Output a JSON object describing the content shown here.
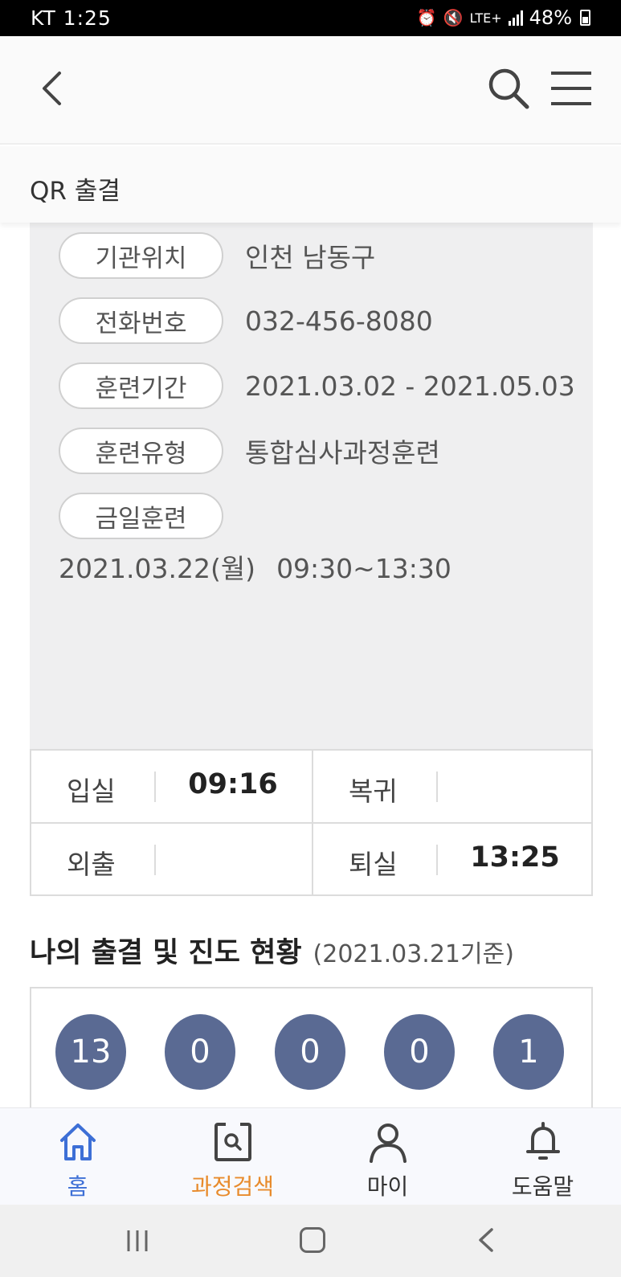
{
  "status_bar": {
    "carrier_time": "KT 1:25",
    "network": "LTE+",
    "battery": "48%"
  },
  "header": {
    "back_icon": "chevron-left-icon",
    "search_icon": "search-icon",
    "menu_icon": "hamburger-menu-icon"
  },
  "subheader": {
    "title": "QR 출결"
  },
  "info": {
    "rows": [
      {
        "label": "기관위치",
        "value": "인천 남동구"
      },
      {
        "label": "전화번호",
        "value": "032-456-8080"
      },
      {
        "label": "훈련기간",
        "value": "2021.03.02 - 2021.05.03"
      },
      {
        "label": "훈련유형",
        "value": "통합심사과정훈련"
      }
    ],
    "today_label": "금일훈련",
    "today_date": "2021.03.22(월)",
    "today_time": "09:30~13:30"
  },
  "attendance": {
    "entry_label": "입실",
    "entry_time": "09:16",
    "return_label": "복귀",
    "return_time": "",
    "out_label": "외출",
    "out_time": "",
    "exit_label": "퇴실",
    "exit_time": "13:25"
  },
  "status": {
    "title": "나의 출결 및 진도 현황",
    "basis": "(2021.03.21기준)",
    "counts": [
      "13",
      "0",
      "0",
      "0",
      "1"
    ],
    "circle_color": "#5a6a93"
  },
  "bottom_nav": {
    "items": [
      {
        "label": "홈",
        "icon": "home-icon",
        "color": "#3d6fd6"
      },
      {
        "label": "과정검색",
        "icon": "course-search-icon",
        "color": "#e88b2c"
      },
      {
        "label": "마이",
        "icon": "person-icon",
        "color": "#333333"
      },
      {
        "label": "도움말",
        "icon": "bell-icon",
        "color": "#333333"
      }
    ]
  }
}
